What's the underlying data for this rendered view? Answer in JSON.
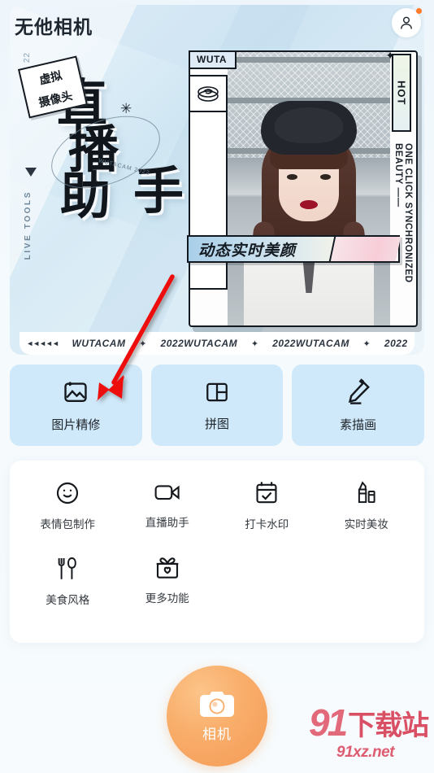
{
  "header": {
    "app_title": "无他相机",
    "avatar_icon": "user-avatar-icon",
    "notification_dot": true
  },
  "hero": {
    "rail_number": "22",
    "rail_text": "LIVE TOOLS",
    "big_title_lines": [
      "直",
      "播",
      "助"
    ],
    "big_title_last": "手",
    "micro_text": "WUTACAM 2022",
    "photo_tab_label": "WUTA",
    "note_line1": "虚拟",
    "note_line2": "摄像头",
    "hot_label": "HOT",
    "vertical_caption": "ONE CLICK SYNCHRONIZED BEAUTY ——",
    "beauty_banner_text": "动态实时美颜",
    "marquee": {
      "arrows": "◄◄◄◄◄",
      "item1": "WUTACAM",
      "sep1": "✦",
      "item2": "2022WUTACAM",
      "sep2": "✦",
      "item3": "2022WUTACAM",
      "sep3": "✦",
      "item4": "2022"
    }
  },
  "action_cards": [
    {
      "label": "图片精修",
      "icon": "image-edit-icon"
    },
    {
      "label": "拼图",
      "icon": "collage-icon"
    },
    {
      "label": "素描画",
      "icon": "pencil-sketch-icon"
    }
  ],
  "features": [
    {
      "label": "表情包制作",
      "icon": "smiley-face-icon"
    },
    {
      "label": "直播助手",
      "icon": "video-camera-icon"
    },
    {
      "label": "打卡水印",
      "icon": "calendar-check-icon"
    },
    {
      "label": "实时美妆",
      "icon": "lipstick-icon"
    },
    {
      "label": "美食风格",
      "icon": "fork-spoon-icon"
    },
    {
      "label": "更多功能",
      "icon": "gift-box-icon"
    }
  ],
  "camera_button": {
    "label": "相机",
    "icon": "camera-icon"
  },
  "watermark": {
    "mark": "91",
    "name": "下载站",
    "url": "91xz.net"
  },
  "colors": {
    "page_bg": "#f4f9fc",
    "card_bg": "#cfe9fa",
    "accent_orange": "#f9ae6b",
    "notification_dot": "#ff7a29",
    "watermark_red": "#de5c70",
    "annotation_arrow": "#ee1111"
  }
}
